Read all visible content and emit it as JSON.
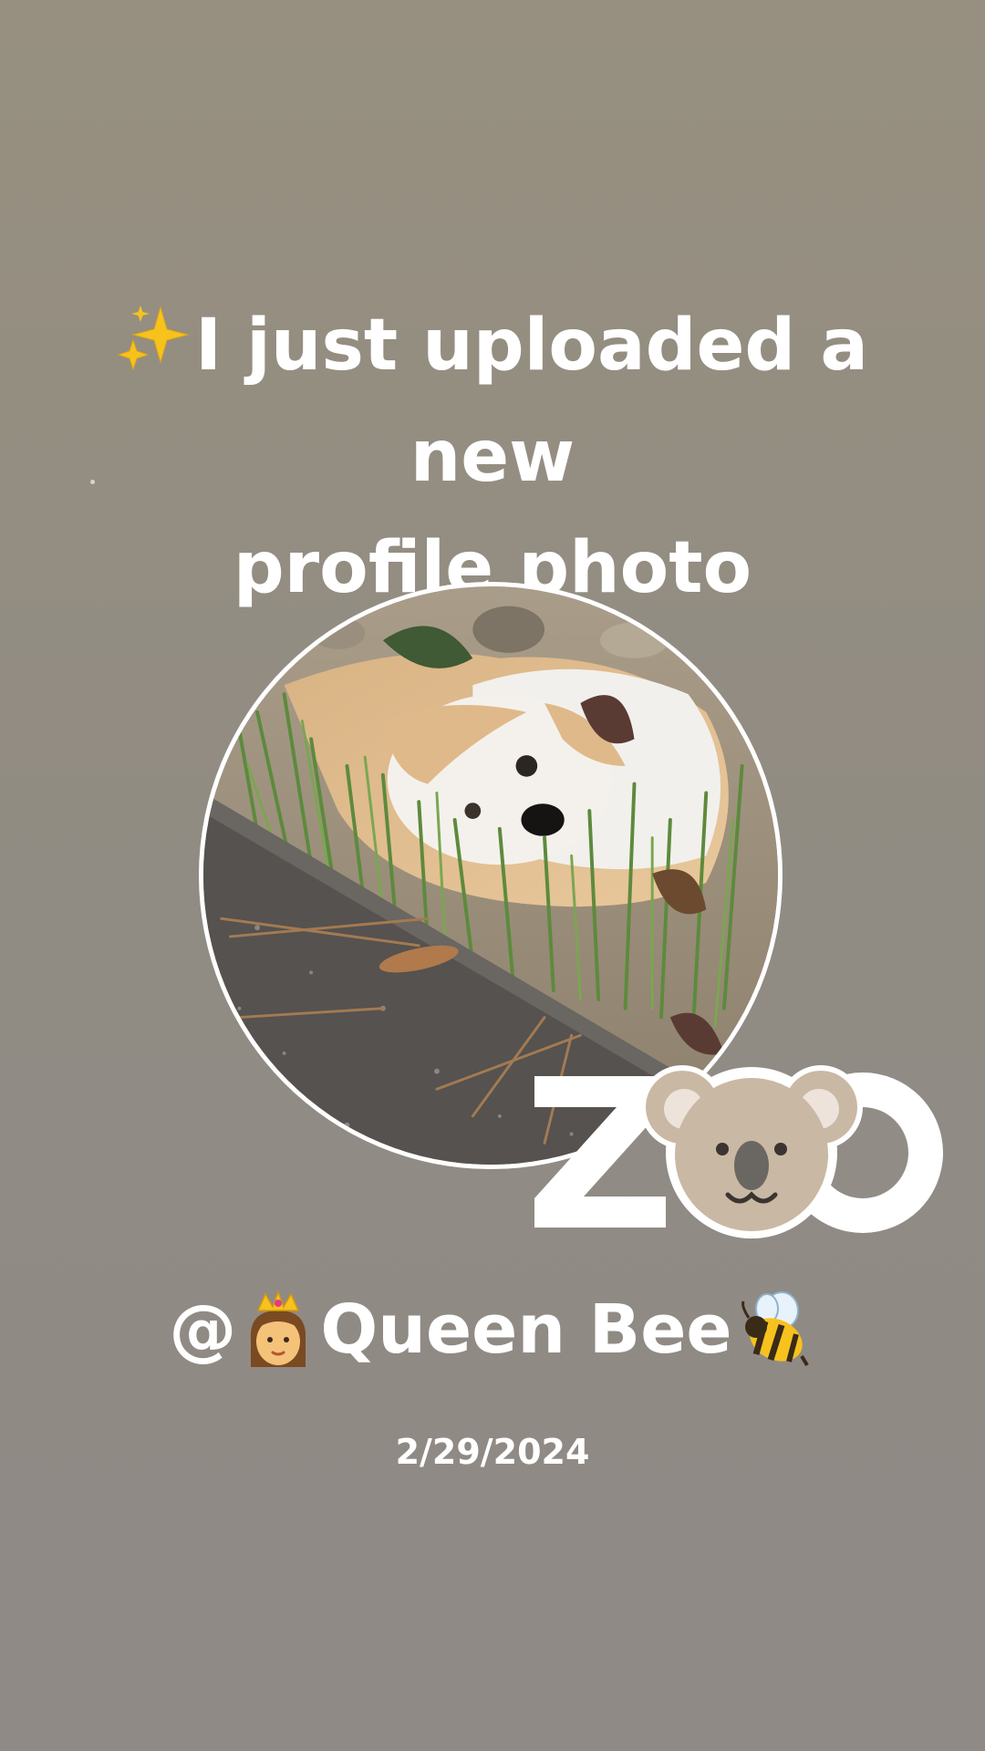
{
  "post": {
    "headline_line1": "I just uploaded a new",
    "headline_line2": "profile photo",
    "handle_prefix": "@",
    "handle_name": "Queen Bee",
    "date": "2/29/2024"
  },
  "brand": {
    "logo_text": "ZOO"
  },
  "icons": {
    "headline_icon": "sparkles-icon",
    "handle_icon_left": "princess-icon",
    "handle_icon_right": "bee-icon",
    "logo_icon": "koala-icon"
  },
  "colors": {
    "background": "#948e85",
    "text": "#ffffff",
    "avatar_border": "#ffffff"
  }
}
